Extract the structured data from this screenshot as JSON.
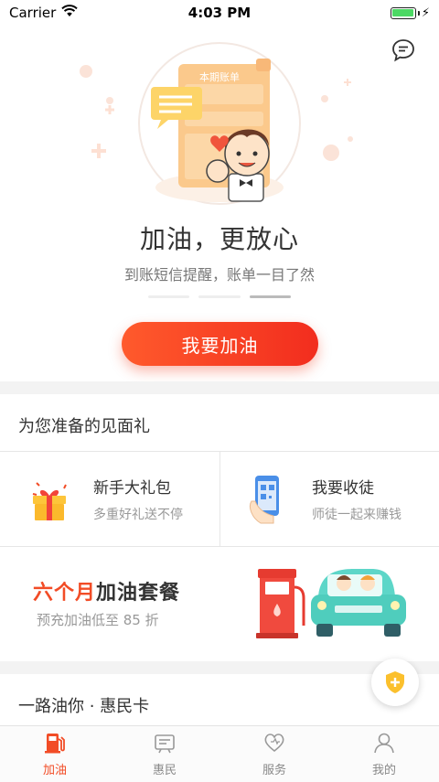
{
  "status_bar": {
    "carrier": "Carrier",
    "time": "4:03 PM"
  },
  "hero": {
    "illustration_label": "本期账单",
    "title": "加油，更放心",
    "subtitle": "到账短信提醒，账单一目了然",
    "indicator_count": 3,
    "active_indicator": 3
  },
  "cta": {
    "label": "我要加油"
  },
  "gift_section": {
    "title": "为您准备的见面礼",
    "cards": [
      {
        "title": "新手大礼包",
        "subtitle": "多重好礼送不停",
        "icon": "gift-icon"
      },
      {
        "title": "我要收徒",
        "subtitle": "师徒一起来赚钱",
        "icon": "phone-qr-icon"
      }
    ]
  },
  "promo": {
    "title_accent": "六个月",
    "title_rest": "加油套餐",
    "subtitle": "预充加油低至 85 折",
    "art": "fuel-pump-car-illustration"
  },
  "card_section": {
    "title": "一路油你 · 惠民卡"
  },
  "fab": {
    "icon": "shield-plus-icon"
  },
  "tabs": [
    {
      "label": "加油",
      "icon": "fuel-pump-icon",
      "active": true
    },
    {
      "label": "惠民",
      "icon": "card-icon",
      "active": false
    },
    {
      "label": "服务",
      "icon": "heart-icon",
      "active": false
    },
    {
      "label": "我的",
      "icon": "person-icon",
      "active": false
    }
  ],
  "colors": {
    "accent": "#f24c26",
    "cta_start": "#ff5a2c",
    "cta_end": "#f22d1e",
    "active_tab": "#f24c26"
  }
}
